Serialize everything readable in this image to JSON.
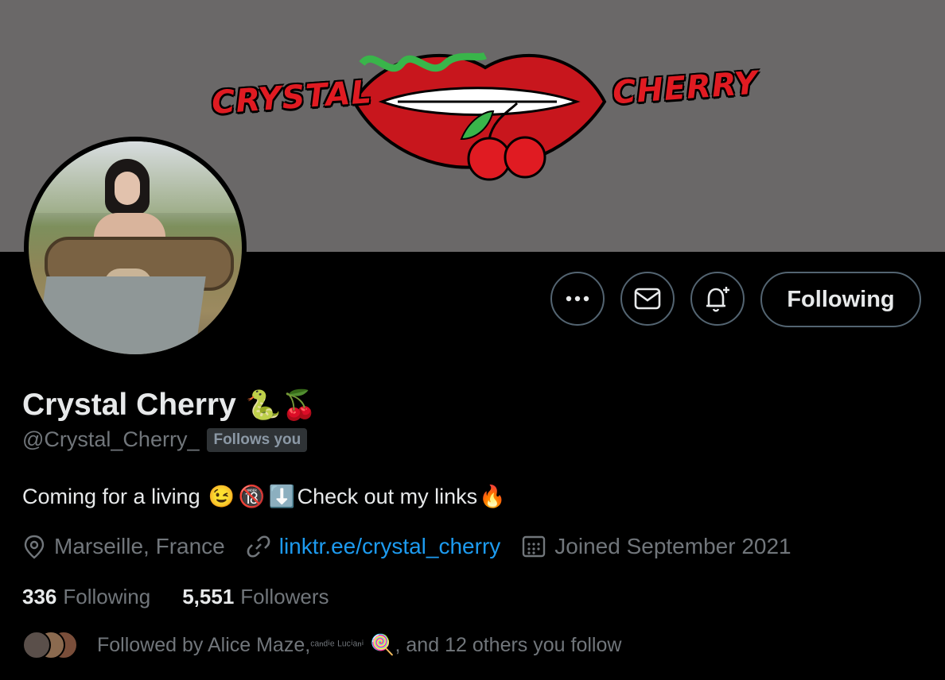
{
  "banner": {
    "logo_left": "CRYSTAL",
    "logo_right": "CHERRY",
    "bg_color": "#6a6868"
  },
  "actions": {
    "more_icon": "more-icon",
    "message_icon": "mail-icon",
    "notify_icon": "bell-plus-icon",
    "following_label": "Following"
  },
  "profile": {
    "name": "Crystal Cherry",
    "name_emoji": "🐍🍒",
    "handle": "@Crystal_Cherry_",
    "follows_you": "Follows you",
    "bio_text_1": "Coming for a living",
    "bio_emoji_1": "😉",
    "bio_emoji_2": "🔞",
    "bio_emoji_3": "⬇️",
    "bio_text_2": "Check out my links",
    "bio_emoji_4": "🔥"
  },
  "meta": {
    "location": "Marseille, France",
    "link": "linktr.ee/crystal_cherry",
    "joined": "Joined September 2021"
  },
  "stats": {
    "following_count": "336",
    "following_label": "Following",
    "followers_count": "5,551",
    "followers_label": "Followers"
  },
  "followed_by": {
    "prefix": "Followed by Alice Maze, ",
    "name2": "ᶜᵃⁿᵈⁱᵉ ᴸᵘᶜⁱᵃⁿⁱ",
    "name2_emoji": "🍭",
    "suffix": ", and 12 others you follow"
  },
  "colors": {
    "accent_link": "#1d9bf0",
    "muted_text": "#71767b",
    "logo_red": "#e01b22"
  }
}
